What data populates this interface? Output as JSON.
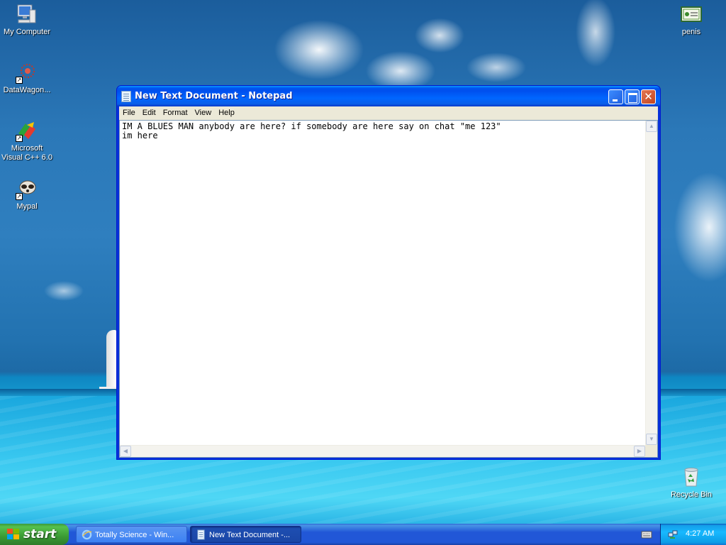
{
  "desktop": {
    "icons": [
      {
        "label": "My Computer",
        "icon": "my-computer-icon"
      },
      {
        "label": "DataWagon...",
        "icon": "datawagon-icon"
      },
      {
        "label": "Microsoft Visual C++ 6.0",
        "icon": "visual-cpp-icon"
      },
      {
        "label": "Mypal",
        "icon": "mypal-icon"
      },
      {
        "label": "penis",
        "icon": "certificate-file-icon"
      },
      {
        "label": "Recycle Bin",
        "icon": "recycle-bin-icon"
      }
    ]
  },
  "window": {
    "title": "New Text Document - Notepad",
    "menu": [
      "File",
      "Edit",
      "Format",
      "View",
      "Help"
    ],
    "content": "IM A BLUES MAN anybody are here? if somebody are here say on chat \"me 123\"\nim here",
    "controls": {
      "minimize": "minimize",
      "maximize": "maximize",
      "close": "✕"
    }
  },
  "taskbar": {
    "start_label": "start",
    "tasks": [
      {
        "label": "Totally Science - Win...",
        "icon": "internet-explorer-icon",
        "active": false
      },
      {
        "label": "New Text Document -...",
        "icon": "notepad-icon",
        "active": true
      }
    ],
    "clock": "4:27 AM"
  },
  "colors": {
    "titlebar": "#0058ee",
    "taskbar": "#2157d7",
    "start": "#3b9b34",
    "tray": "#18b9ff"
  }
}
